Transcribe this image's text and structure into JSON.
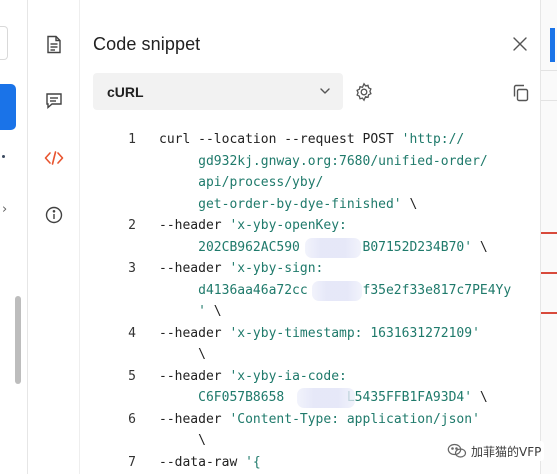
{
  "panel": {
    "title": "Code snippet",
    "language": "cURL"
  },
  "icons": {
    "rail": [
      "document-icon",
      "comment-icon",
      "code-icon",
      "info-icon"
    ],
    "header": [
      "close-icon",
      "chevron-down-icon",
      "gear-icon",
      "copy-icon"
    ]
  },
  "colors": {
    "active_icon": "#e8542f",
    "string": "#1f7a6b",
    "accent_blue": "#1a73e8"
  },
  "code": {
    "line_numbers": [
      "1",
      "2",
      "3",
      "4",
      "5",
      "6",
      "7"
    ],
    "lines": [
      [
        {
          "t": "curl --location --request POST ",
          "c": "k"
        },
        {
          "t": "'http://",
          "c": "s"
        }
      ],
      [
        {
          "t": "     gd932kj.gnway.org:7680/unified-order/",
          "c": "s"
        }
      ],
      [
        {
          "t": "     api/process/yby/",
          "c": "s"
        }
      ],
      [
        {
          "t": "     get-order-by-dye-finished'",
          "c": "s"
        },
        {
          "t": " \\",
          "c": "k"
        }
      ],
      [
        {
          "t": "--header ",
          "c": "k"
        },
        {
          "t": "'x-yby-openKey:",
          "c": "s"
        }
      ],
      [
        {
          "t": "     202CB962AC590        B07152D234B70'",
          "c": "s"
        },
        {
          "t": " \\",
          "c": "k"
        }
      ],
      [
        {
          "t": "--header ",
          "c": "k"
        },
        {
          "t": "'x-yby-sign:",
          "c": "s"
        }
      ],
      [
        {
          "t": "     d4136aa46a72cc       f35e2f33e817c7PE4Yy",
          "c": "s"
        }
      ],
      [
        {
          "t": "     '",
          "c": "s"
        },
        {
          "t": " \\",
          "c": "k"
        }
      ],
      [
        {
          "t": "--header ",
          "c": "k"
        },
        {
          "t": "'x-yby-timestamp: 1631631272109'",
          "c": "s"
        }
      ],
      [
        {
          "t": "     \\",
          "c": "k"
        }
      ],
      [
        {
          "t": "--header ",
          "c": "k"
        },
        {
          "t": "'x-yby-ia-code:",
          "c": "s"
        }
      ],
      [
        {
          "t": "     C6F057B8658        L5435FFB1FA93D4'",
          "c": "s"
        },
        {
          "t": " \\",
          "c": "k"
        }
      ],
      [
        {
          "t": "--header ",
          "c": "k"
        },
        {
          "t": "'Content-Type: application/json'",
          "c": "s"
        }
      ],
      [
        {
          "t": "     \\",
          "c": "k"
        }
      ],
      [
        {
          "t": "--data-raw ",
          "c": "k"
        },
        {
          "t": "'{",
          "c": "s"
        }
      ]
    ]
  },
  "watermark": {
    "text": "加菲猫的VFP"
  }
}
